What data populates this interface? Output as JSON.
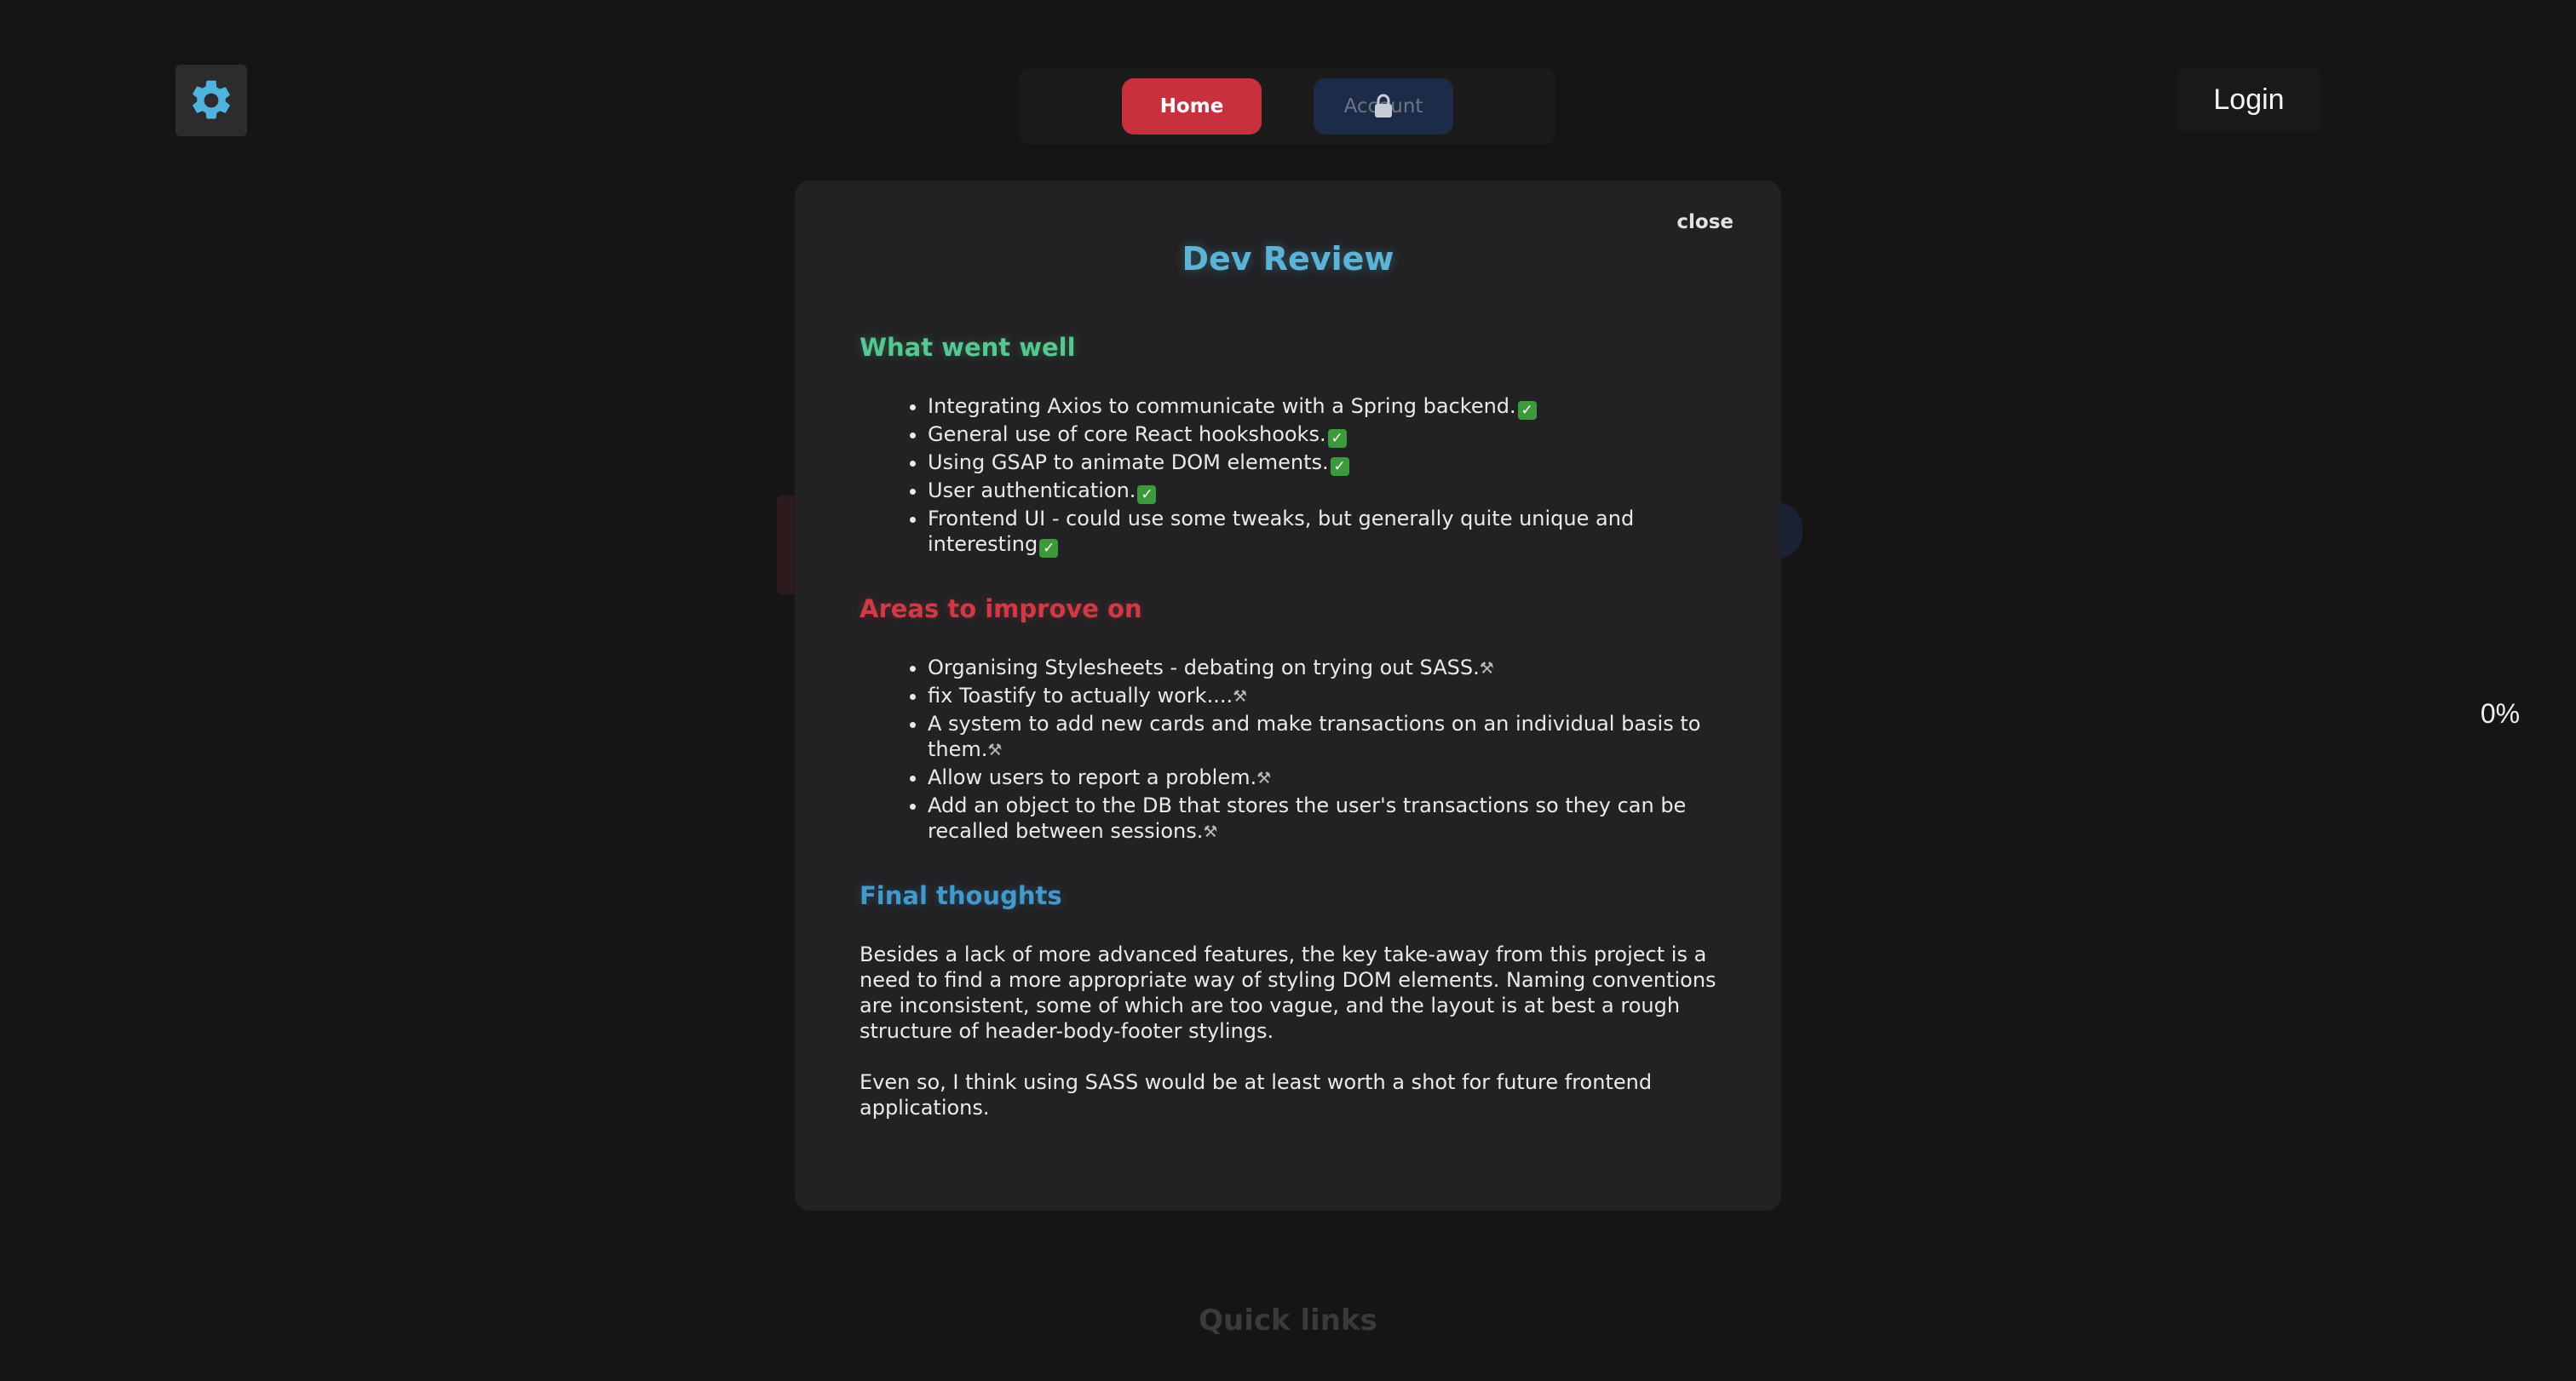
{
  "header": {
    "settings_icon": "gear-icon",
    "nav": {
      "home_label": "Home",
      "account_label": "Account",
      "account_icon": "lock-icon"
    },
    "login_label": "Login"
  },
  "progress_text": "0%",
  "quick_links_label": "Quick links",
  "modal": {
    "close_label": "close",
    "title": "Dev Review",
    "sections": {
      "went_well": {
        "heading": "What went well",
        "items": [
          "Integrating Axios to communicate with a Spring backend.",
          "General use of core React hookshooks.",
          "Using GSAP to animate DOM elements.",
          "User authentication.",
          "Frontend UI - could use some tweaks, but generally quite unique and interesting"
        ],
        "item_icon": "check-mark-icon"
      },
      "improve": {
        "heading": "Areas to improve on",
        "items": [
          "Organising Stylesheets - debating on trying out SASS.",
          "fix Toastify to actually work....",
          "A system to add new cards and make transactions on an individual basis to them.",
          "Allow users to report a problem.",
          "Add an object to the DB that stores the user's transactions so they can be recalled between sessions."
        ],
        "item_icon": "tools-icon"
      },
      "final": {
        "heading": "Final thoughts",
        "paragraphs": [
          "Besides a lack of more advanced features, the key take-away from this project is a need to find a more appropriate way of styling DOM elements. Naming conventions are inconsistent, some of which are too vague, and the layout is at best a rough structure of header-body-footer stylings.",
          "Even so, I think using SASS would be at least worth a shot for future frontend applications."
        ]
      }
    }
  },
  "colors": {
    "background": "#151515",
    "modal_bg": "#222224",
    "home_btn": "#c8303d",
    "account_btn": "#1c2b47",
    "title": "#5cb3d6",
    "went_well": "#55c790",
    "improve": "#d13a45",
    "final": "#4398cc",
    "gear": "#4fb3dd"
  }
}
